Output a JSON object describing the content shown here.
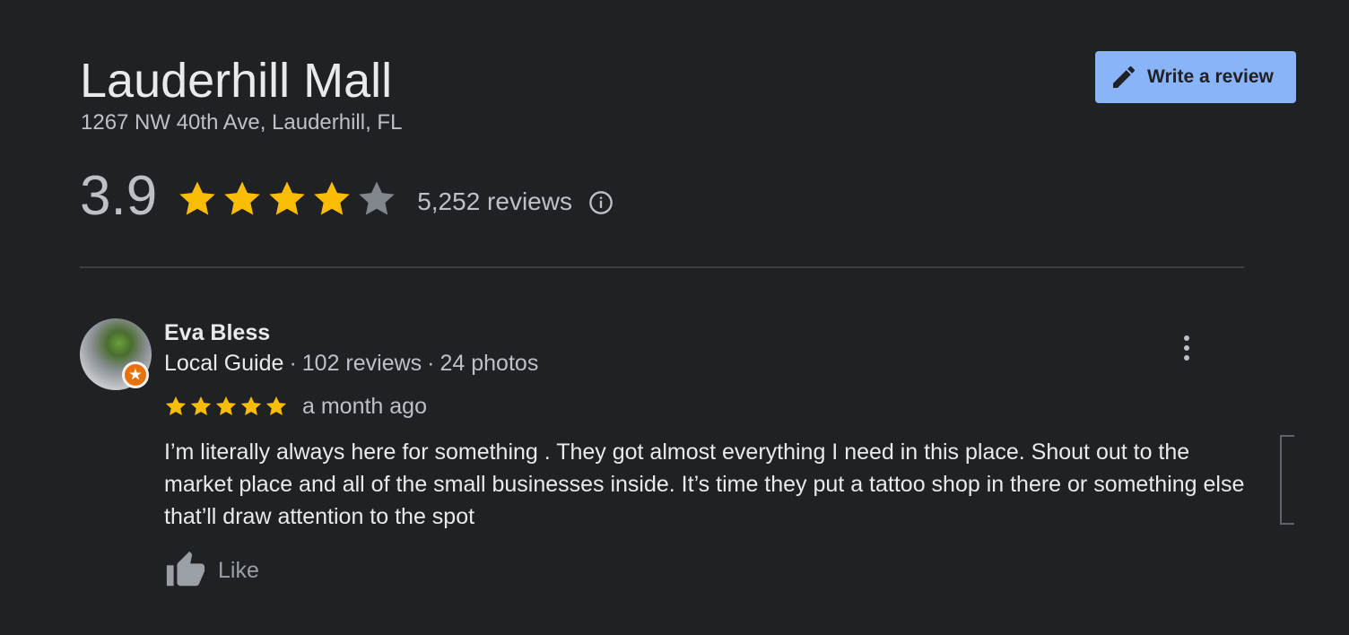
{
  "place": {
    "title": "Lauderhill Mall",
    "address": "1267 NW 40th Ave, Lauderhill, FL"
  },
  "actions": {
    "write_review_label": "Write a review",
    "write_review_icon": "pencil-icon"
  },
  "rating": {
    "value": "3.9",
    "stars_filled": 4,
    "stars_total": 5,
    "review_count": "5,252 reviews",
    "info_icon": "info-icon"
  },
  "colors": {
    "background": "#202124",
    "accent": "#8ab4f8",
    "star": "#fbbc04",
    "star_empty": "#80868b",
    "badge": "#e8710a"
  },
  "review": {
    "author": "Eva Bless",
    "badge_label": "Local Guide",
    "separator": "·",
    "author_reviews": "102 reviews",
    "author_photos": "24 photos",
    "stars": 5,
    "age": "a month ago",
    "text": "I’m literally always here for something . They got almost everything I need in this place. Shout out to the market place and all of the small businesses inside. It’s time they put a tattoo shop in there or something else that’ll draw attention to the spot",
    "like_label": "Like",
    "more_icon": "more-vert-icon",
    "like_icon": "thumb-up-icon"
  }
}
